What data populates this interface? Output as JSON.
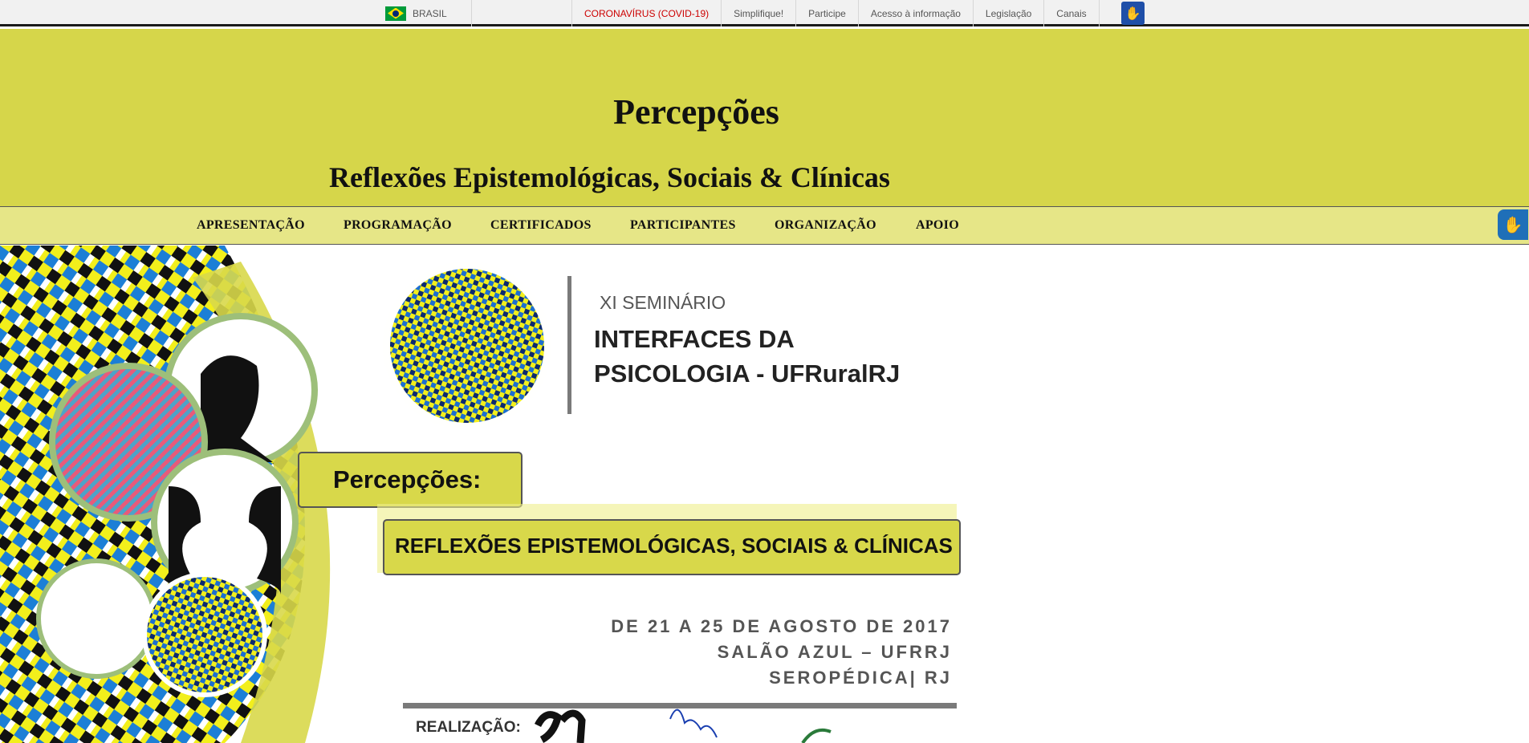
{
  "gov_bar": {
    "country": "BRASIL",
    "links": [
      "CORONAVÍRUS (COVID-19)",
      "Simplifique!",
      "Participe",
      "Acesso à informação",
      "Legislação",
      "Canais"
    ]
  },
  "header": {
    "title": "Percepções",
    "subtitle": "Reflexões Epistemológicas, Sociais & Clínicas"
  },
  "nav": {
    "items": [
      "APRESENTAÇÃO",
      "PROGRAMAÇÃO",
      "CERTIFICADOS",
      "PARTICIPANTES",
      "ORGANIZAÇÃO",
      "APOIO"
    ]
  },
  "banner": {
    "edition": "XI SEMINÁRIO",
    "name_line1": "INTERFACES DA",
    "name_line2": "PSICOLOGIA - UFRuralRJ",
    "theme": "Percepções:",
    "theme_subtitle": "REFLEXÕES EPISTEMOLÓGICAS, SOCIAIS & CLÍNICAS",
    "dates": "DE 21 A 25 DE AGOSTO DE 2017",
    "venue": "SALÃO AZUL – UFRRJ",
    "city": "SEROPÉDICA| RJ",
    "realizacao": "REALIZAÇÃO:"
  },
  "colors": {
    "header_bg": "#d6d64a",
    "nav_bg": "#e6e687",
    "covid_link": "#cc0000",
    "accent_blue": "#1f4fa8"
  },
  "icons": {
    "flag": "brazil-flag-icon",
    "accessibility": "vlibras-hands-icon"
  }
}
